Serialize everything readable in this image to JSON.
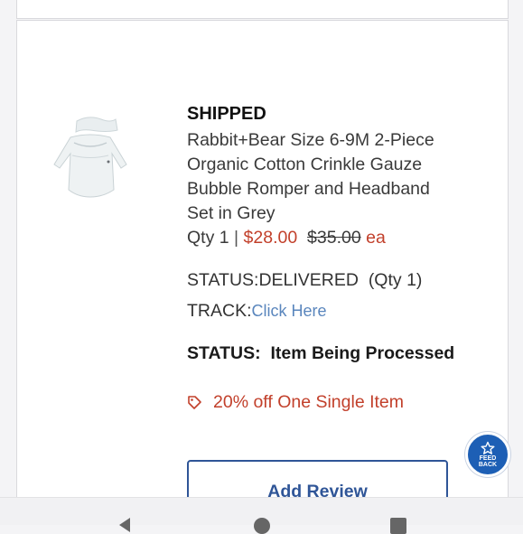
{
  "order_item": {
    "shipped_label": "SHIPPED",
    "title": "Rabbit+Bear Size 6-9M 2-Piece Organic Cotton Crinkle Gauze Bubble Romper and Headband Set in Grey",
    "qty_text": "Qty 1",
    "separator": "|",
    "price": "$28.00",
    "original_price": "$35.00",
    "unit": "ea",
    "status_line": "STATUS:DELIVERED  (Qty 1)",
    "track_label": "TRACK:",
    "track_link": "Click Here",
    "status2_label": "STATUS:",
    "status2_value": "Item Being Processed",
    "promo": "20% off One Single Item",
    "add_review": "Add Review"
  },
  "feedback": {
    "line1": "FEED",
    "line2": "BACK"
  },
  "icons": {
    "promo": "tag-icon",
    "feedback": "star-icon",
    "nav": [
      "back-icon",
      "home-icon",
      "recents-icon"
    ]
  },
  "colors": {
    "accent_red": "#c2402b",
    "link_blue": "#5a86bd",
    "button_blue": "#2f5597",
    "feedback_blue": "#1d5fb5"
  }
}
